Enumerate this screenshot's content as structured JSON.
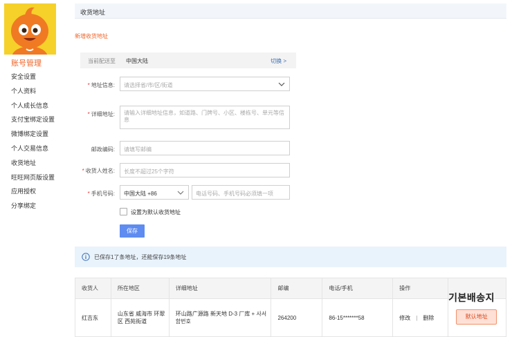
{
  "sidebar": {
    "title": "账号管理",
    "items": [
      "安全设置",
      "个人资料",
      "个人成长信息",
      "支付宝绑定设置",
      "微博绑定设置",
      "个人交易信息",
      "收货地址",
      "旺旺网页版设置",
      "应用授权",
      "分享绑定"
    ]
  },
  "header": {
    "title": "收货地址"
  },
  "form": {
    "new_title": "新增收货地址",
    "deliver_label": "当前配送至",
    "deliver_value": "中国大陆",
    "switch_label": "切换 >",
    "region_label": "地址信息:",
    "region_placeholder": "请选择省/市/区/街道",
    "detail_label": "详细地址:",
    "detail_placeholder": "请输入详细地址信息，如道路、门牌号、小区、楼栋号、单元等信息",
    "zip_label": "邮政编码:",
    "zip_placeholder": "请填写邮编",
    "name_label": "收货人姓名:",
    "name_placeholder": "长度不超过25个字符",
    "phone_label": "手机号码:",
    "phone_region": "中国大陆 +86",
    "phone_placeholder": "电话号码、手机号码必须填一项",
    "default_checkbox_label": "设置为默认收货地址",
    "save_label": "保存"
  },
  "info": {
    "text": "已保存1了条地址，还能保存19条地址"
  },
  "table": {
    "headers": [
      "收货人",
      "所在地区",
      "详细地址",
      "邮编",
      "电话/手机",
      "操作",
      ""
    ],
    "rows": [
      {
        "name": "红吉东",
        "region": "山东省 威海市 环翠区 西苑街道",
        "address": "环山路广源路 新天地 D-3 厂库 + 사서함번호",
        "zip": "264200",
        "phone": "86-15*******58",
        "edit": "修改",
        "sep": "|",
        "delete": "删除",
        "overlay_text": "기본배송지",
        "default_label": "默认地址"
      }
    ]
  },
  "colors": {
    "accent": "#f06326",
    "link": "#3a6fb4",
    "button": "#5e8cf0",
    "info_bg": "#e9f3fc"
  }
}
